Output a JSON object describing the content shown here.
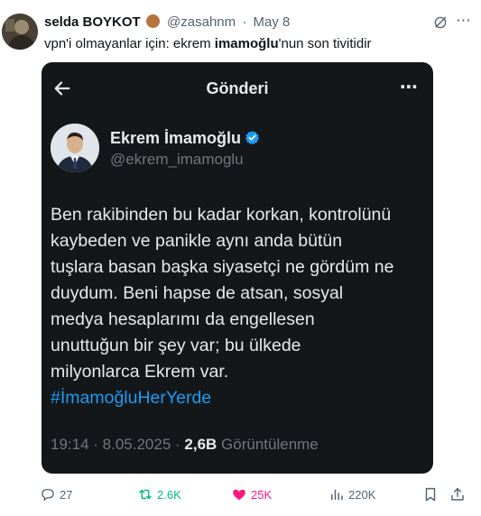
{
  "author": {
    "name": "selda BOYKOT",
    "handle": "@zasahnm",
    "separator": "·",
    "date": "May 8"
  },
  "post_text": {
    "before": "vpn'i olmayanlar için: ekrem ",
    "bold": "imamoğlu",
    "after": "'nun son tivitidir"
  },
  "screenshot": {
    "page_title": "Gönderi",
    "quoted": {
      "name": "Ekrem İmamoğlu",
      "handle": "@ekrem_imamoglu",
      "body_lines": [
        "Ben rakibinden bu kadar korkan, kontrolünü",
        "kaybeden ve panikle aynı anda bütün",
        "tuşlara basan başka siyasetçi ne gördüm ne",
        "duydum. Beni hapse de atsan, sosyal",
        "medya hesaplarımı da engellesen",
        "unuttuğun bir şey var; bu ülkede",
        "milyonlarca Ekrem var."
      ],
      "hashtag": "#İmamoğluHerYerde",
      "time": "19:14 · 8.05.2025 · ",
      "views": "2,6B",
      "views_label": " Görüntülenme"
    }
  },
  "actions": {
    "replies": "27",
    "reposts": "2.6K",
    "likes": "25K",
    "views": "220K"
  },
  "colors": {
    "accent_blue": "#1d9bf0",
    "repost_green": "#00ba7c",
    "like_pink": "#f91880",
    "screenshot_bg": "#14171a"
  }
}
